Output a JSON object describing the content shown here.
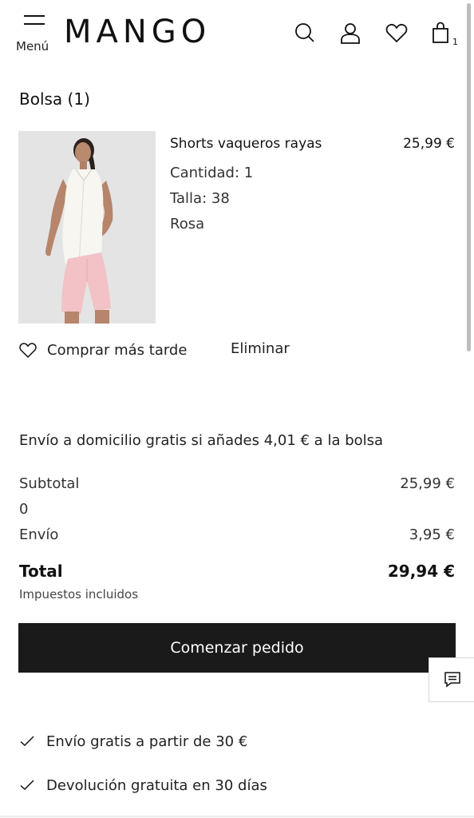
{
  "header": {
    "menu_label": "Menú",
    "logo": "MANGO",
    "bag_count": "1",
    "icons": [
      "search-icon",
      "user-icon",
      "heart-icon",
      "bag-icon",
      "menu-icon"
    ]
  },
  "bag": {
    "title": "Bolsa (1)",
    "item": {
      "name": "Shorts vaqueros rayas",
      "price": "25,99 €",
      "quantity": "Cantidad: 1",
      "size": "Talla: 38",
      "color": "Rosa",
      "buy_later": "Comprar más tarde",
      "remove": "Eliminar"
    }
  },
  "summary": {
    "shipping_note": "Envío a domicilio gratis si añades 4,01 € a la bolsa",
    "subtotal_label": "Subtotal",
    "subtotal_value": "25,99 €",
    "discount_value": "0",
    "shipping_label": "Envío",
    "shipping_value": "3,95 €",
    "total_label": "Total",
    "total_value": "29,94 €",
    "tax_note": "Impuestos incluidos"
  },
  "checkout": {
    "button_label": "Comenzar pedido"
  },
  "benefits": [
    "Envío gratis a partir de 30 €",
    "Devolución gratuita en 30 días"
  ],
  "colors": {
    "button_bg": "#1a1a1a",
    "text": "#111111",
    "image_bg": "#e4e4e4",
    "shorts": "#f2c2c6",
    "top": "#f7f6f1"
  }
}
